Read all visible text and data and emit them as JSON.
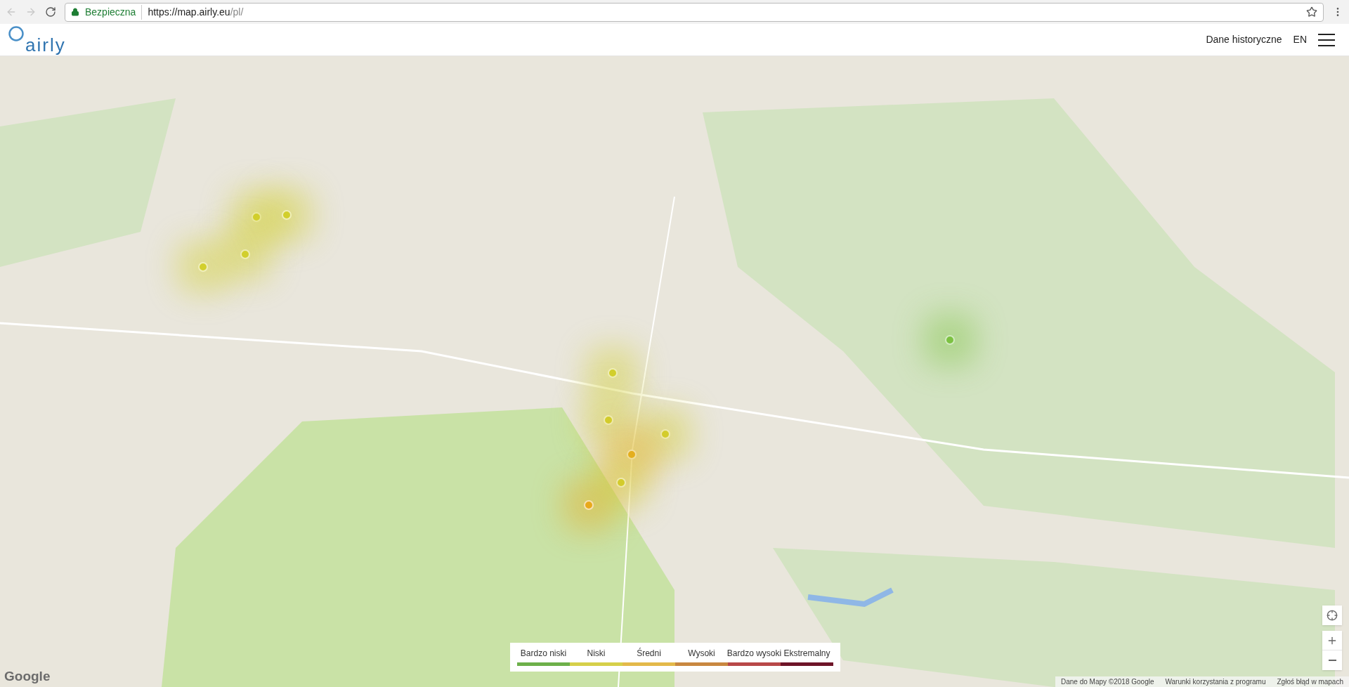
{
  "browser": {
    "security_label": "Bezpieczna",
    "url_host": "https://map.airly.eu",
    "url_path": "/pl/"
  },
  "header": {
    "logo": "airly",
    "links": [
      {
        "label": "Dane historyczne"
      },
      {
        "label": "EN"
      }
    ]
  },
  "map": {
    "markers": [
      {
        "color": "#d2cf2e"
      },
      {
        "color": "#d2cf2e"
      },
      {
        "color": "#d2cf2e"
      },
      {
        "color": "#d2cf2e"
      },
      {
        "color": "#d2cf2e"
      },
      {
        "color": "#d2cf2e"
      },
      {
        "color": "#d2cf2e"
      },
      {
        "color": "#e8a91c"
      },
      {
        "color": "#d2cf2e"
      },
      {
        "color": "#e8a91c"
      },
      {
        "color": "#7cc242"
      }
    ],
    "legend": [
      {
        "label": "Bardzo niski",
        "color": "#6db04a"
      },
      {
        "label": "Niski",
        "color": "#d6d04a"
      },
      {
        "label": "Średni",
        "color": "#e3b94a"
      },
      {
        "label": "Wysoki",
        "color": "#c98840"
      },
      {
        "label": "Bardzo wysoki",
        "color": "#b84848"
      },
      {
        "label": "Ekstremalny",
        "color": "#6e1428"
      }
    ],
    "google_logo": "Google",
    "attribution": [
      "Dane do Mapy ©2018 Google",
      "Warunki korzystania z programu",
      "Zgłoś błąd w mapach"
    ]
  }
}
